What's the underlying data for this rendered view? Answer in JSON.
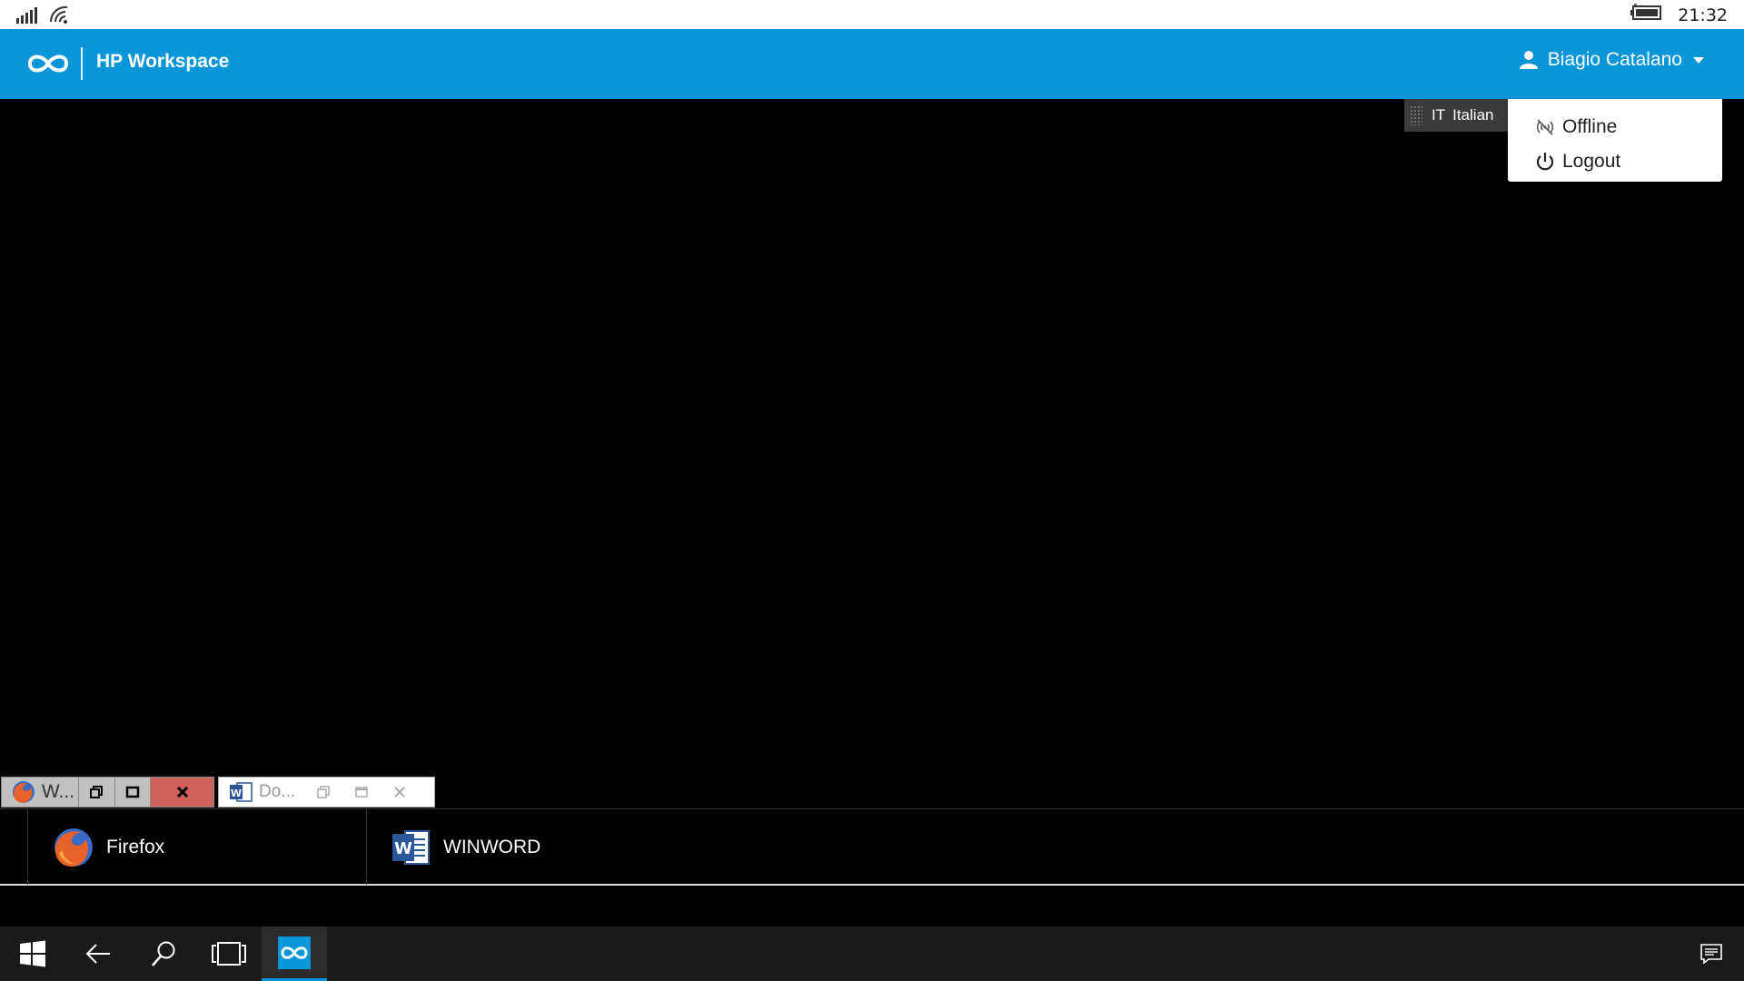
{
  "status_bar": {
    "time": "21:32"
  },
  "app_header": {
    "title": "HP Workspace",
    "user_name": "Biagio Catalano"
  },
  "language": {
    "code": "IT",
    "name": "Italian"
  },
  "user_dropdown": {
    "offline_label": "Offline",
    "logout_label": "Logout"
  },
  "remote_windows": [
    {
      "title": "W..."
    },
    {
      "title": "Do..."
    }
  ],
  "remote_taskbar": [
    {
      "label": "Firefox"
    },
    {
      "label": "WINWORD"
    }
  ],
  "colors": {
    "accent": "#0896d8",
    "close_button": "#d0605a"
  }
}
